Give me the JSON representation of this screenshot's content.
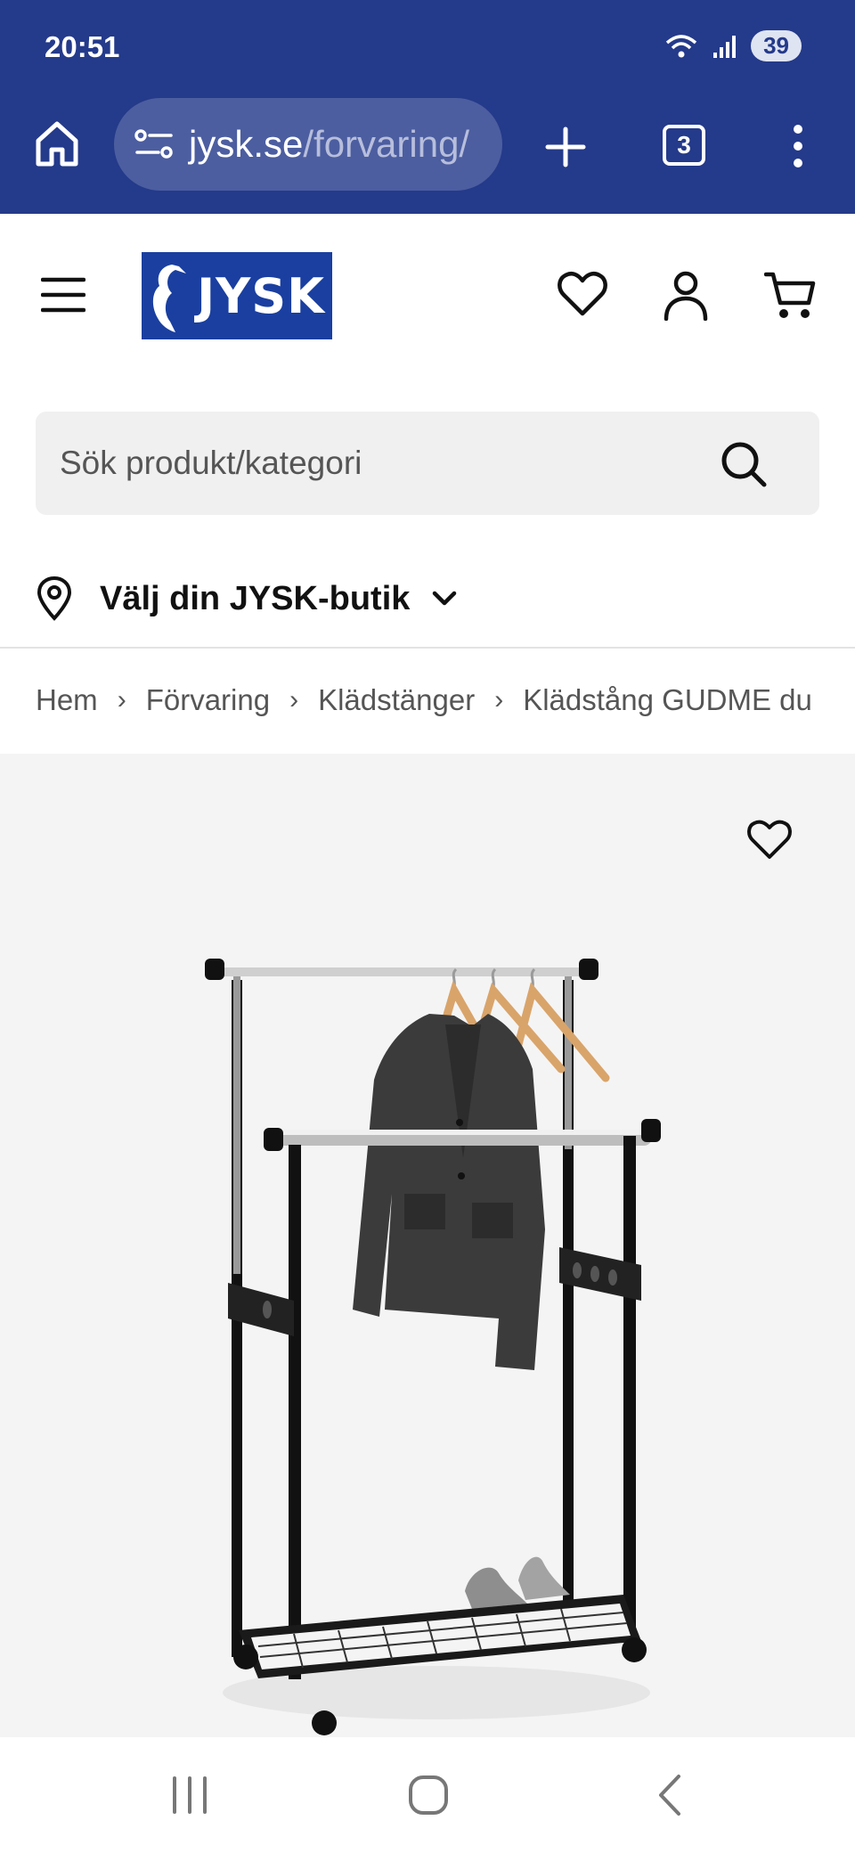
{
  "status_bar": {
    "time": "20:51",
    "battery": "39"
  },
  "browser": {
    "url_domain": "jysk.se",
    "url_path": "/forvaring/",
    "tab_count": "3"
  },
  "header": {
    "logo_text": "JYSK",
    "logo_color": "#1a3fa0"
  },
  "search": {
    "placeholder": "Sök produkt/kategori"
  },
  "store": {
    "label": "Välj din JYSK-butik"
  },
  "breadcrumb": {
    "items": [
      "Hem",
      "Förvaring",
      "Klädstänger",
      "Klädstång GUDME du"
    ]
  },
  "colors": {
    "chrome": "#243a8a",
    "brand": "#1a3fa0"
  }
}
